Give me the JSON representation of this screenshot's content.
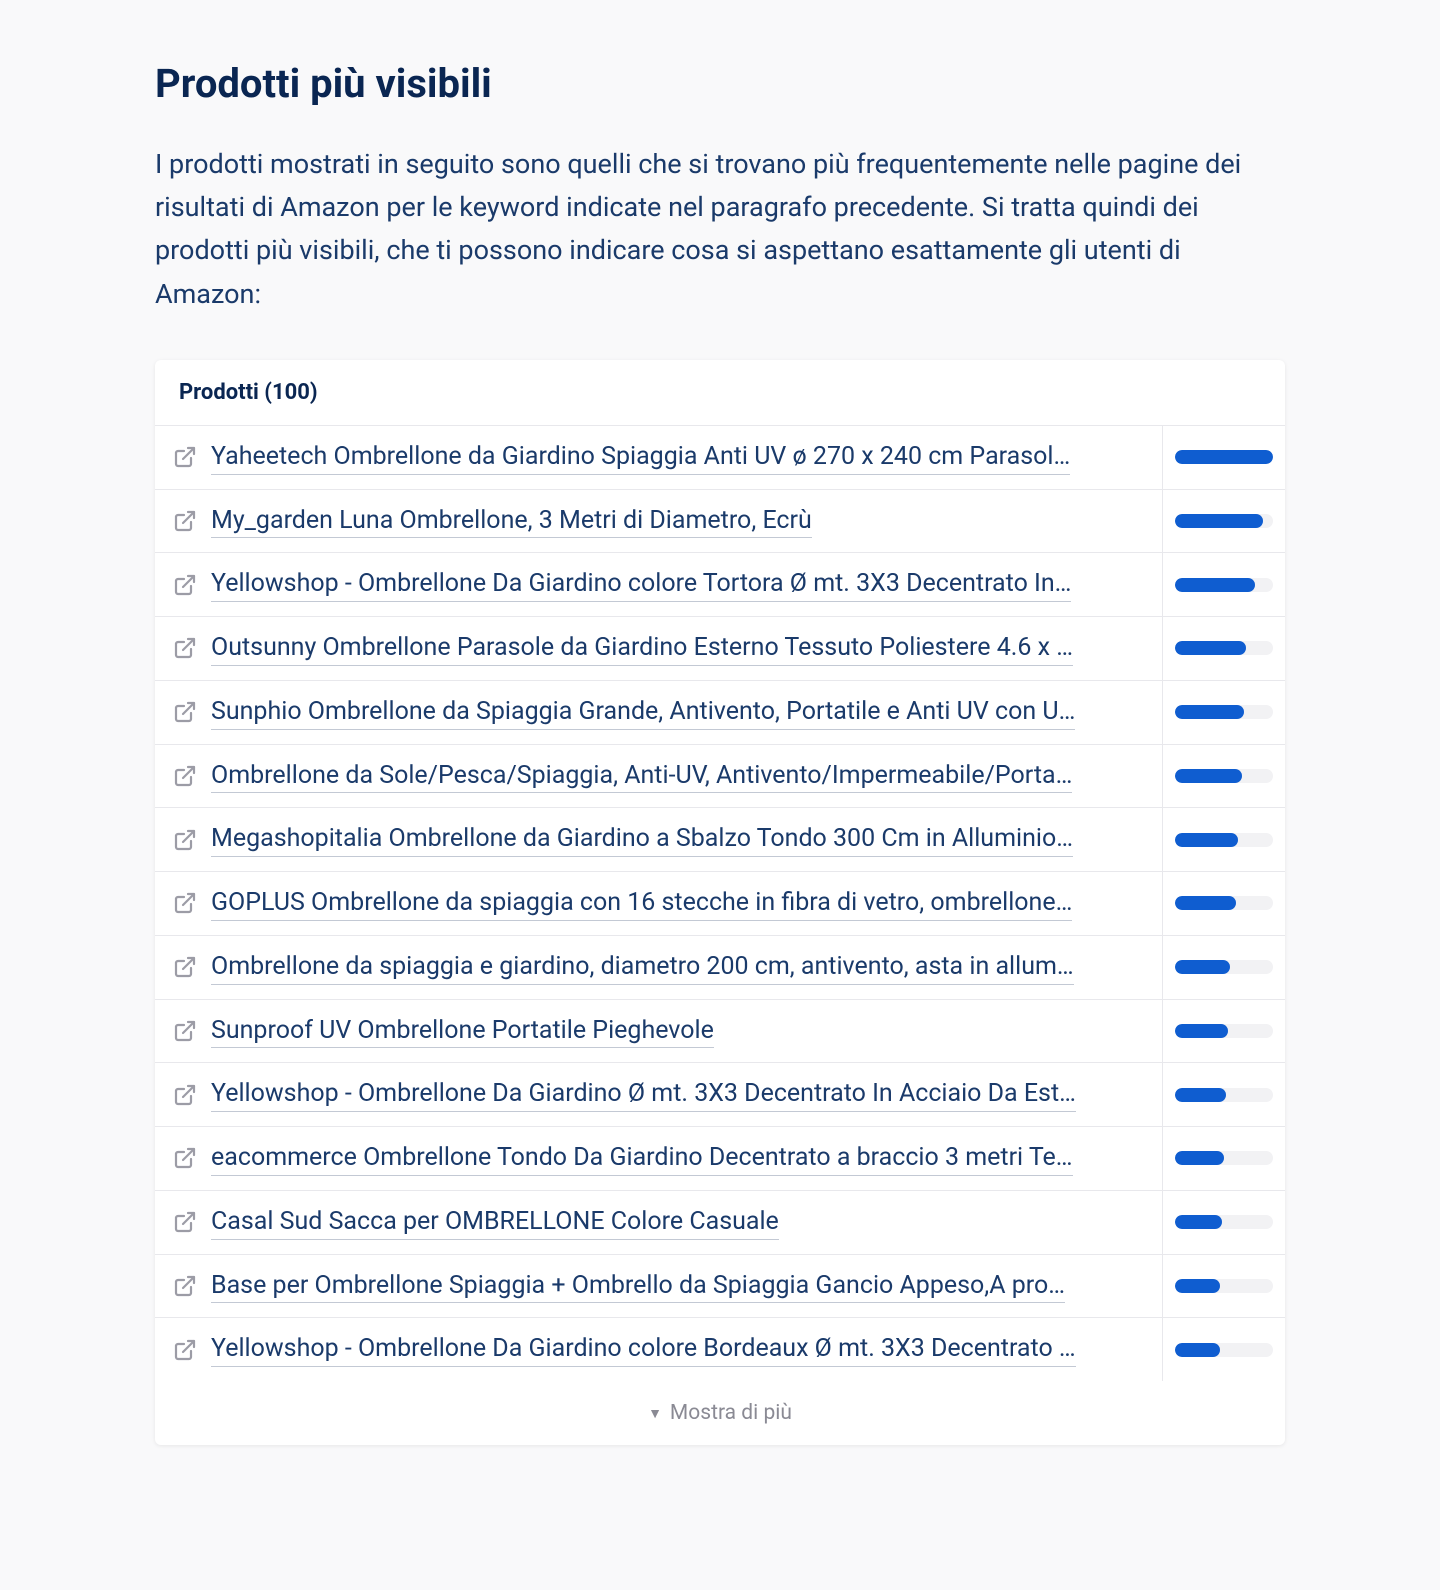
{
  "header": {
    "title": "Prodotti più visibili",
    "description": "I prodotti mostrati in seguito sono quelli che si trovano più frequentemente nelle pagine dei risultati di Amazon per le keyword indicate nel paragrafo precedente. Si tratta quindi dei prodotti più visibili, che ti possono indicare cosa si aspettano esattamente gli utenti di Amazon:"
  },
  "table": {
    "header_label": "Prodotti (100)",
    "show_more_label": "Mostra di più",
    "rows": [
      {
        "title": "Yaheetech Ombrellone da Giardino Spiaggia Anti UV ø 270 x 240 cm Parasol…",
        "bar": 100
      },
      {
        "title": "My_garden Luna Ombrellone, 3 Metri di Diametro, Ecrù",
        "bar": 90
      },
      {
        "title": "Yellowshop - Ombrellone Da Giardino colore Tortora Ø mt. 3X3 Decentrato In…",
        "bar": 82
      },
      {
        "title": "Outsunny Ombrellone Parasole da Giardino Esterno Tessuto Poliestere 4.6 x …",
        "bar": 72
      },
      {
        "title": "Sunphio Ombrellone da Spiaggia Grande, Antivento, Portatile e Anti UV con U…",
        "bar": 70
      },
      {
        "title": "Ombrellone da Sole/Pesca/Spiaggia, Anti-UV, Antivento/Impermeabile/Porta…",
        "bar": 68
      },
      {
        "title": "Megashopitalia Ombrellone da Giardino a Sbalzo Tondo 300 Cm in Alluminio…",
        "bar": 64
      },
      {
        "title": "GOPLUS Ombrellone da spiaggia con 16 stecche in fibra di vetro, ombrellone…",
        "bar": 62
      },
      {
        "title": "Ombrellone da spiaggia e giardino, diametro 200 cm, antivento, asta in allum…",
        "bar": 56
      },
      {
        "title": "Sunproof UV Ombrellone Portatile Pieghevole",
        "bar": 54
      },
      {
        "title": "Yellowshop - Ombrellone Da Giardino Ø mt. 3X3 Decentrato In Acciaio Da Est…",
        "bar": 52
      },
      {
        "title": "eacommerce Ombrellone Tondo Da Giardino Decentrato a braccio 3 metri Te…",
        "bar": 50
      },
      {
        "title": "Casal Sud Sacca per OMBRELLONE Colore Casuale",
        "bar": 48
      },
      {
        "title": "Base per Ombrellone Spiaggia + Ombrello da Spiaggia Gancio Appeso,A pro…",
        "bar": 46
      },
      {
        "title": "Yellowshop - Ombrellone Da Giardino colore Bordeaux Ø mt. 3X3 Decentrato …",
        "bar": 46
      }
    ]
  }
}
